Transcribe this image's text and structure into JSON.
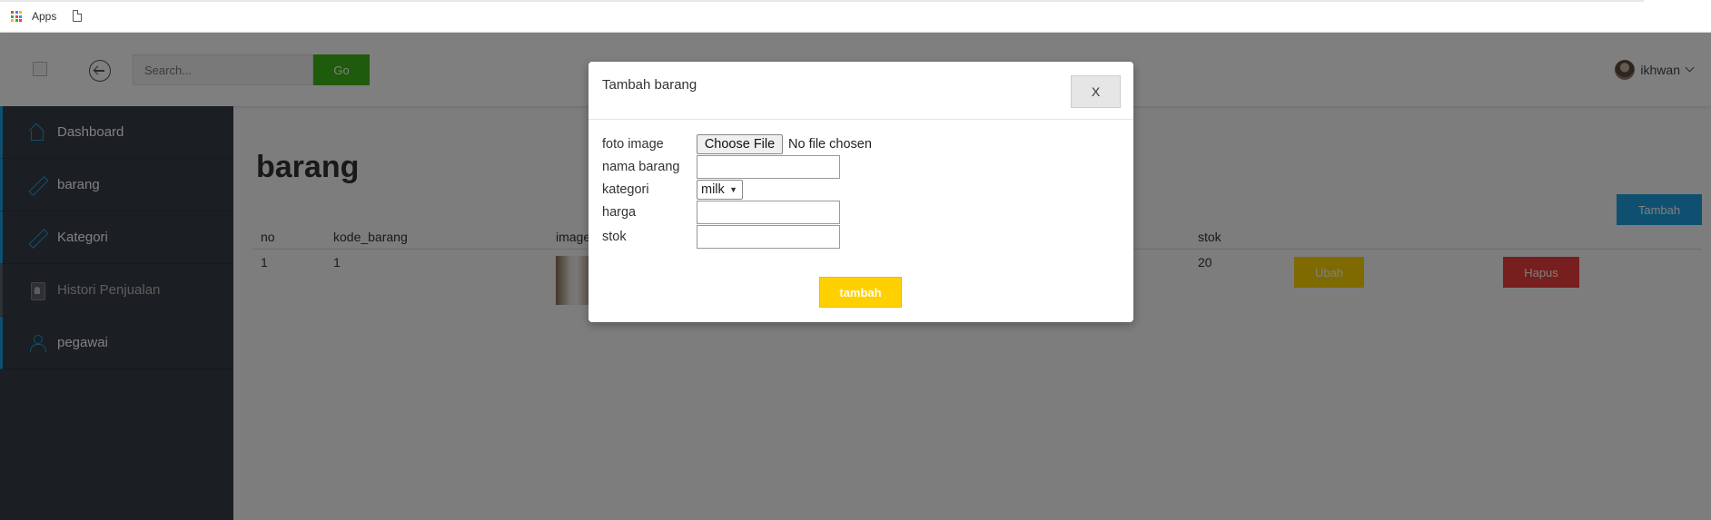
{
  "browser": {
    "apps_label": "Apps",
    "apps_icon_colors": [
      "#ea4335",
      "#4285f4",
      "#fbbc05",
      "#34a853",
      "#ea4335",
      "#4285f4",
      "#fbbc05",
      "#34a853",
      "#ea4335"
    ]
  },
  "header": {
    "search_placeholder": "Search...",
    "go_label": "Go",
    "user_name": "ikhwan"
  },
  "sidebar": {
    "items": [
      {
        "label": "Dashboard",
        "icon": "home-icon"
      },
      {
        "label": "barang",
        "icon": "pencil-icon"
      },
      {
        "label": "Kategori",
        "icon": "pencil-icon"
      },
      {
        "label": "Histori Penjualan",
        "icon": "report-icon"
      },
      {
        "label": "pegawai",
        "icon": "user-icon"
      }
    ]
  },
  "main": {
    "title": "barang",
    "add_label": "Tambah",
    "columns": {
      "no": "no",
      "kode": "kode_barang",
      "image": "image",
      "stok": "stok"
    },
    "row": {
      "no": "1",
      "kode": "1",
      "stok": "20",
      "edit_label": "Ubah",
      "delete_label": "Hapus"
    }
  },
  "modal": {
    "title": "Tambah barang",
    "close_label": "X",
    "fields": {
      "foto": "foto image",
      "nama": "nama barang",
      "kategori": "kategori",
      "harga": "harga",
      "stok": "stok"
    },
    "file_button": "Choose File",
    "file_status": "No file chosen",
    "kategori_value": "milk",
    "submit_label": "tambah"
  },
  "colors": {
    "accent": "#1fa1e3",
    "go": "#3fb618",
    "warning": "#ffd000",
    "danger": "#ef3c3c",
    "sidebar": "#373e47"
  }
}
